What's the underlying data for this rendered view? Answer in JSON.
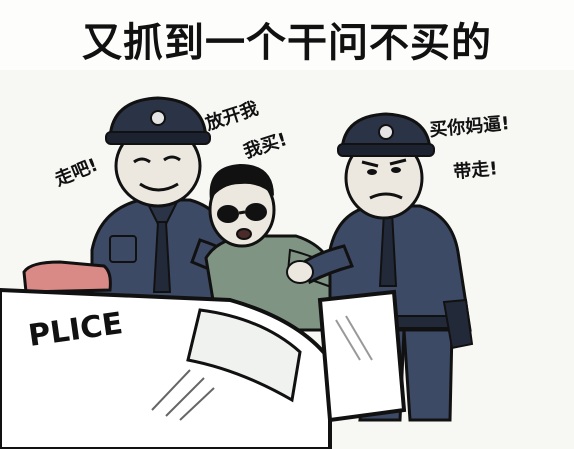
{
  "caption": "又抓到一个干问不买的",
  "speech": {
    "left_officer": "走吧!",
    "suspect_line1": "放开我",
    "suspect_line2": "我买!",
    "right_officer_line1": "买你妈逼!",
    "right_officer_line2": "带走!"
  },
  "car_label": "PLICE",
  "colors": {
    "uniform": "#3d4a66",
    "uniform_dark": "#222a3a",
    "face": "#ece8df",
    "shirt": "#7f9483",
    "siren": "#d98a86",
    "ink": "#111111"
  }
}
